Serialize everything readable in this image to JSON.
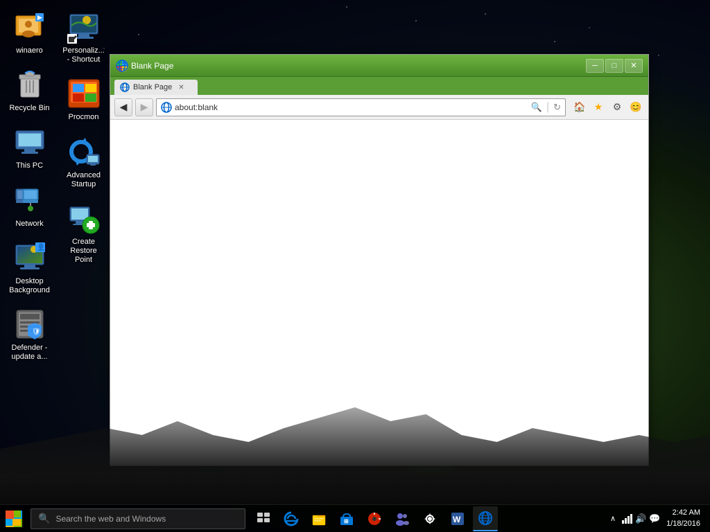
{
  "desktop": {
    "background_color": "#0a0a18"
  },
  "icons_col1": [
    {
      "id": "winaero",
      "label": "winaero",
      "emoji": "👤",
      "color": "#e8a020"
    },
    {
      "id": "recycle-bin",
      "label": "Recycle Bin",
      "emoji": "🗑️",
      "color": "#aaaaaa"
    },
    {
      "id": "this-pc",
      "label": "This PC",
      "emoji": "🖥️",
      "color": "#4488cc"
    },
    {
      "id": "network",
      "label": "Network",
      "emoji": "🌐",
      "color": "#4488cc"
    },
    {
      "id": "desktop-background",
      "label": "Desktop Background",
      "emoji": "🖼️",
      "color": "#4488cc"
    },
    {
      "id": "defender",
      "label": "Defender - update a...",
      "emoji": "🛡️",
      "color": "#888888"
    }
  ],
  "icons_col2": [
    {
      "id": "personalize",
      "label": "Personaliz... - Shortcut",
      "emoji": "🖥️",
      "color": "#4488cc"
    },
    {
      "id": "procmon",
      "label": "Procmon",
      "emoji": "📊",
      "color": "#cc4400"
    },
    {
      "id": "advanced-startup",
      "label": "Advanced Startup",
      "emoji": "🔄",
      "color": "#2288dd"
    },
    {
      "id": "create-restore",
      "label": "Create Restore Point",
      "emoji": "💾",
      "color": "#2266cc"
    }
  ],
  "browser": {
    "title": "Blank Page",
    "title_icon": "🌐",
    "address": "about:blank",
    "address_icon": "🌐",
    "min_btn": "─",
    "max_btn": "□",
    "close_btn": "✕",
    "back_btn": "◀",
    "forward_btn": "▶",
    "search_placeholder": "about:blank",
    "tab_label": "Blank Page",
    "home_icon": "🏠",
    "fav_icon": "★",
    "settings_icon": "⚙",
    "smiley_icon": "😊",
    "titlebar_bg": "#4a9a28"
  },
  "taskbar": {
    "search_placeholder": "Search the web and Windows",
    "clock_time": "2:42 AM",
    "clock_date": "1/18/2016",
    "start_label": "Start",
    "icons": [
      {
        "id": "task-view",
        "label": "Task View",
        "emoji": "⊞",
        "active": false
      },
      {
        "id": "edge",
        "label": "Microsoft Edge",
        "emoji": "◉",
        "active": false,
        "color": "#0078d7"
      },
      {
        "id": "explorer",
        "label": "File Explorer",
        "emoji": "📁",
        "active": false,
        "color": "#ffcc00"
      },
      {
        "id": "store",
        "label": "Store",
        "emoji": "🛍️",
        "active": false
      },
      {
        "id": "media",
        "label": "Media",
        "emoji": "🎬",
        "active": false
      },
      {
        "id": "people",
        "label": "People",
        "emoji": "👥",
        "active": false
      },
      {
        "id": "settings",
        "label": "Settings",
        "emoji": "⚙️",
        "active": false
      },
      {
        "id": "word",
        "label": "Word",
        "emoji": "📝",
        "active": false
      },
      {
        "id": "ie",
        "label": "Internet Explorer",
        "emoji": "🌐",
        "active": true,
        "color": "#0066cc"
      }
    ],
    "tray_icons": [
      {
        "id": "chevron",
        "emoji": "∧"
      },
      {
        "id": "network-tray",
        "emoji": "📶"
      },
      {
        "id": "volume",
        "emoji": "🔊"
      },
      {
        "id": "message",
        "emoji": "💬"
      }
    ]
  }
}
